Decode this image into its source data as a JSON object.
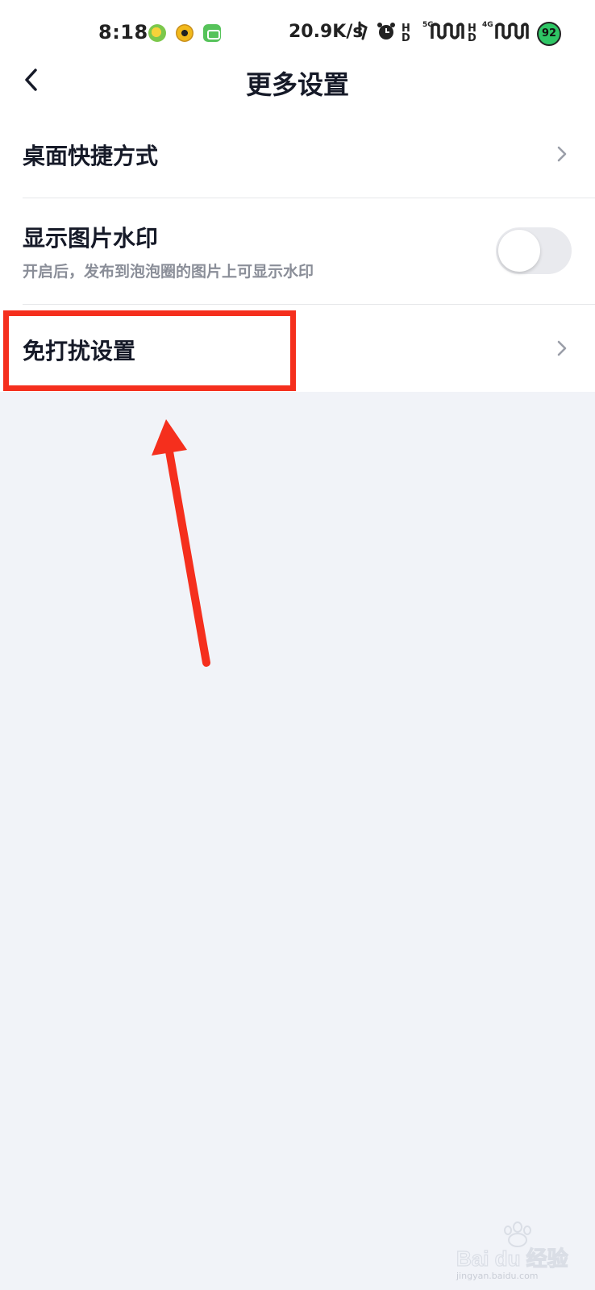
{
  "status_bar": {
    "time": "8:18",
    "net_speed": "20.9K/s",
    "sim1_label": "5G",
    "sim2_label": "4G",
    "battery": "92",
    "icons": [
      "app-notification-icon",
      "app-notification-icon",
      "app-notification-icon",
      "vibrate-icon",
      "alarm-icon",
      "hd-icon",
      "signal-icon",
      "hd-icon",
      "signal-icon",
      "battery-icon"
    ]
  },
  "header": {
    "title": "更多设置",
    "back_icon": "chevron-left-icon"
  },
  "settings": {
    "desktop_shortcut": {
      "label": "桌面快捷方式"
    },
    "image_watermark": {
      "label": "显示图片水印",
      "description": "开启后，发布到泡泡圈的图片上可显示水印",
      "enabled": false
    },
    "do_not_disturb": {
      "label": "免打扰设置"
    }
  },
  "watermark": {
    "logo": "Baidu经验",
    "url": "jingyan.baidu.com"
  },
  "colors": {
    "annotation": "#f52f1d",
    "background": "#f1f3f8",
    "toggle_off": "#e9eaee"
  }
}
